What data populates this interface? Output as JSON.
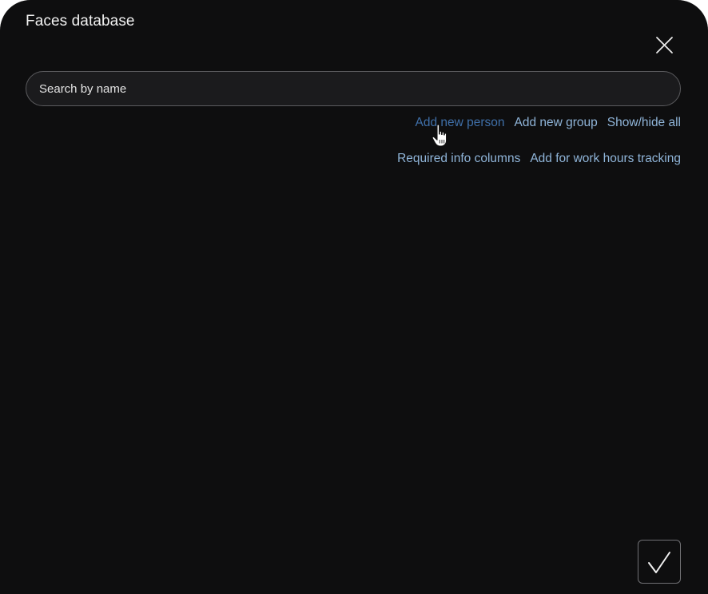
{
  "dialog": {
    "title": "Faces database",
    "close_icon": "close-icon",
    "confirm_icon": "checkmark-icon"
  },
  "search": {
    "placeholder": "Search by name",
    "value": ""
  },
  "actions_row1": [
    {
      "label": "Add new person"
    },
    {
      "label": "Add new group"
    },
    {
      "label": "Show/hide all"
    }
  ],
  "actions_row2": [
    {
      "label": "Required info columns"
    },
    {
      "label": "Add for work hours tracking"
    }
  ],
  "colors": {
    "background": "#0e0e0f",
    "link": "#8fb4d8",
    "link_hover": "#3f6fa8",
    "text": "#f2f2f2"
  }
}
